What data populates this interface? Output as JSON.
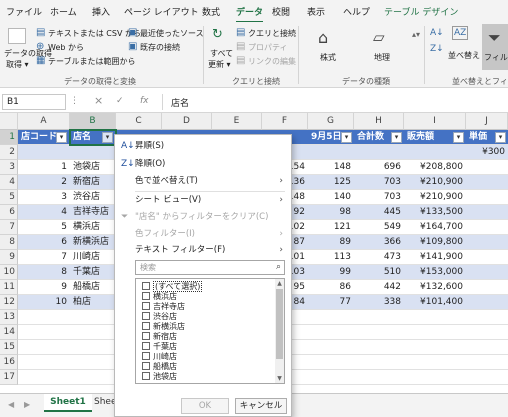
{
  "ribbon_tabs": [
    "ファイル",
    "ホーム",
    "挿入",
    "ページ レイアウト",
    "数式",
    "データ",
    "校閲",
    "表示",
    "ヘルプ",
    "テーブル デザイン"
  ],
  "ribbon": {
    "get_data": "データの取得",
    "get_data_sub": "取得 ▾",
    "from_text_csv": "テキストまたは CSV から",
    "from_web": "Web から",
    "from_table": "テーブルまたは範囲から",
    "recent_sources": "最近使ったソース",
    "existing_conn": "既存の接続",
    "group_get_transform": "データの取得と変換",
    "refresh_all": "すべて",
    "refresh_all_sub": "更新 ▾",
    "queries_conn": "クエリと接続",
    "properties": "プロパティ",
    "edit_links": "リンクの編集",
    "group_queries": "クエリと接続",
    "stocks": "株式",
    "geography": "地理",
    "group_data_types": "データの種類",
    "sort_label": "並べ替え",
    "filter_label": "フィルター",
    "group_sort_filter": "並べ替えとフィル"
  },
  "name_box": "B1",
  "formula_content": "店名",
  "columns": [
    "A",
    "B",
    "C",
    "D",
    "E",
    "F",
    "G",
    "H",
    "I",
    "J"
  ],
  "rows": [
    "1",
    "2",
    "3",
    "4",
    "5",
    "6",
    "7",
    "8",
    "9",
    "10",
    "11",
    "12",
    "13",
    "14",
    "15",
    "16",
    "17"
  ],
  "table": {
    "headers": [
      "店コード",
      "店名",
      "",
      "",
      "",
      "",
      "9月5日",
      "合計数",
      "販売額",
      "単価"
    ],
    "row2_unit": "¥300",
    "data": [
      {
        "code": "1",
        "name": "池袋店",
        "f": "154",
        "g": "148",
        "h": "696",
        "i": "¥208,800"
      },
      {
        "code": "2",
        "name": "新宿店",
        "f": "136",
        "g": "125",
        "h": "703",
        "i": "¥210,900"
      },
      {
        "code": "3",
        "name": "渋谷店",
        "f": "148",
        "g": "140",
        "h": "703",
        "i": "¥210,900"
      },
      {
        "code": "4",
        "name": "吉祥寺店",
        "f": "92",
        "g": "98",
        "h": "445",
        "i": "¥133,500"
      },
      {
        "code": "5",
        "name": "横浜店",
        "f": "102",
        "g": "121",
        "h": "549",
        "i": "¥164,700"
      },
      {
        "code": "6",
        "name": "新横浜店",
        "f": "87",
        "g": "89",
        "h": "366",
        "i": "¥109,800"
      },
      {
        "code": "7",
        "name": "川崎店",
        "f": "101",
        "g": "113",
        "h": "473",
        "i": "¥141,900"
      },
      {
        "code": "8",
        "name": "千葉店",
        "f": "103",
        "g": "99",
        "h": "510",
        "i": "¥153,000"
      },
      {
        "code": "9",
        "name": "船橋店",
        "f": "95",
        "g": "86",
        "h": "442",
        "i": "¥132,600"
      },
      {
        "code": "10",
        "name": "柏店",
        "f": "84",
        "g": "77",
        "h": "338",
        "i": "¥101,400"
      }
    ]
  },
  "sheet_tabs": {
    "active": "Sheet1",
    "other": "Shee"
  },
  "filter_menu": {
    "sort_asc": "昇順(S)",
    "sort_desc": "降順(O)",
    "sort_by_color": "色で並べ替え(T)",
    "sheet_view": "シート ビュー(V)",
    "clear_filter": "\"店名\" からフィルターをクリア(C)",
    "color_filter": "色フィルター(I)",
    "text_filter": "テキスト フィルター(F)",
    "search_placeholder": "検索",
    "items": [
      "(すべて選択)",
      "横浜店",
      "吉祥寺店",
      "渋谷店",
      "新横浜店",
      "新宿店",
      "千葉店",
      "川崎店",
      "船橋店",
      "池袋店"
    ],
    "ok": "OK",
    "cancel": "キャンセル"
  }
}
